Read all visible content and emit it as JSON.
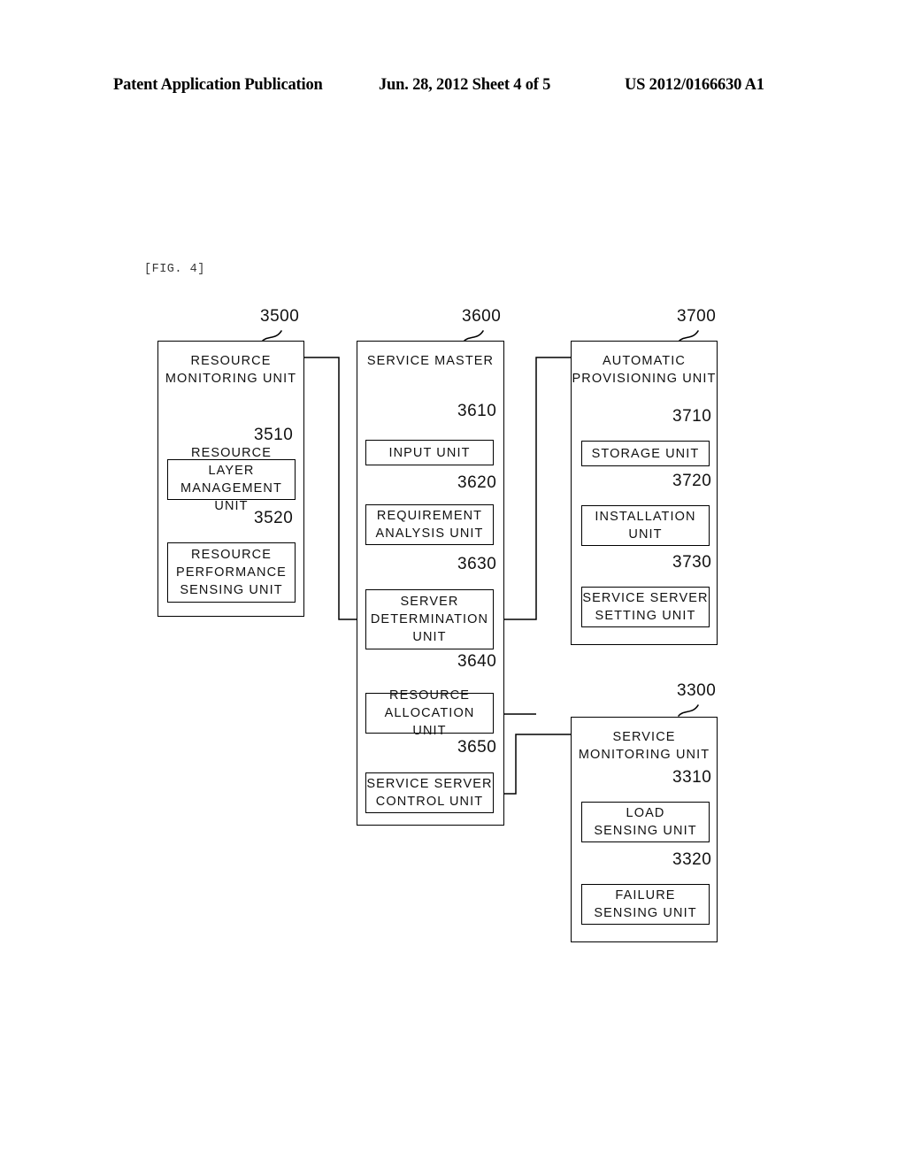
{
  "header": {
    "left": "Patent Application Publication",
    "middle": "Jun. 28, 2012  Sheet 4 of 5",
    "right": "US 2012/0166630 A1"
  },
  "figure": {
    "label": "[FIG. 4]"
  },
  "diagram": {
    "blocks": [
      {
        "ref": "3500",
        "title": "RESOURCE\nMONITORING UNIT",
        "children": [
          {
            "ref": "3510",
            "title": "RESOURCE LAYER\nMANAGEMENT UNIT"
          },
          {
            "ref": "3520",
            "title": "RESOURCE\nPERFORMANCE\nSENSING UNIT"
          }
        ]
      },
      {
        "ref": "3600",
        "title": "SERVICE MASTER",
        "children": [
          {
            "ref": "3610",
            "title": "INPUT UNIT"
          },
          {
            "ref": "3620",
            "title": "REQUIREMENT\nANALYSIS UNIT"
          },
          {
            "ref": "3630",
            "title": "SERVER\nDETERMINATION\nUNIT"
          },
          {
            "ref": "3640",
            "title": "RESOURCE\nALLOCATION UNIT"
          },
          {
            "ref": "3650",
            "title": "SERVICE SERVER\nCONTROL UNIT"
          }
        ]
      },
      {
        "ref": "3700",
        "title": "AUTOMATIC\nPROVISIONING UNIT",
        "children": [
          {
            "ref": "3710",
            "title": "STORAGE UNIT"
          },
          {
            "ref": "3720",
            "title": "INSTALLATION\nUNIT"
          },
          {
            "ref": "3730",
            "title": "SERVICE SERVER\nSETTING UNIT"
          }
        ]
      },
      {
        "ref": "3300",
        "title": "SERVICE\nMONITORING UNIT",
        "children": [
          {
            "ref": "3310",
            "title": "LOAD\nSENSING UNIT"
          },
          {
            "ref": "3320",
            "title": "FAILURE\nSENSING UNIT"
          }
        ]
      }
    ]
  }
}
